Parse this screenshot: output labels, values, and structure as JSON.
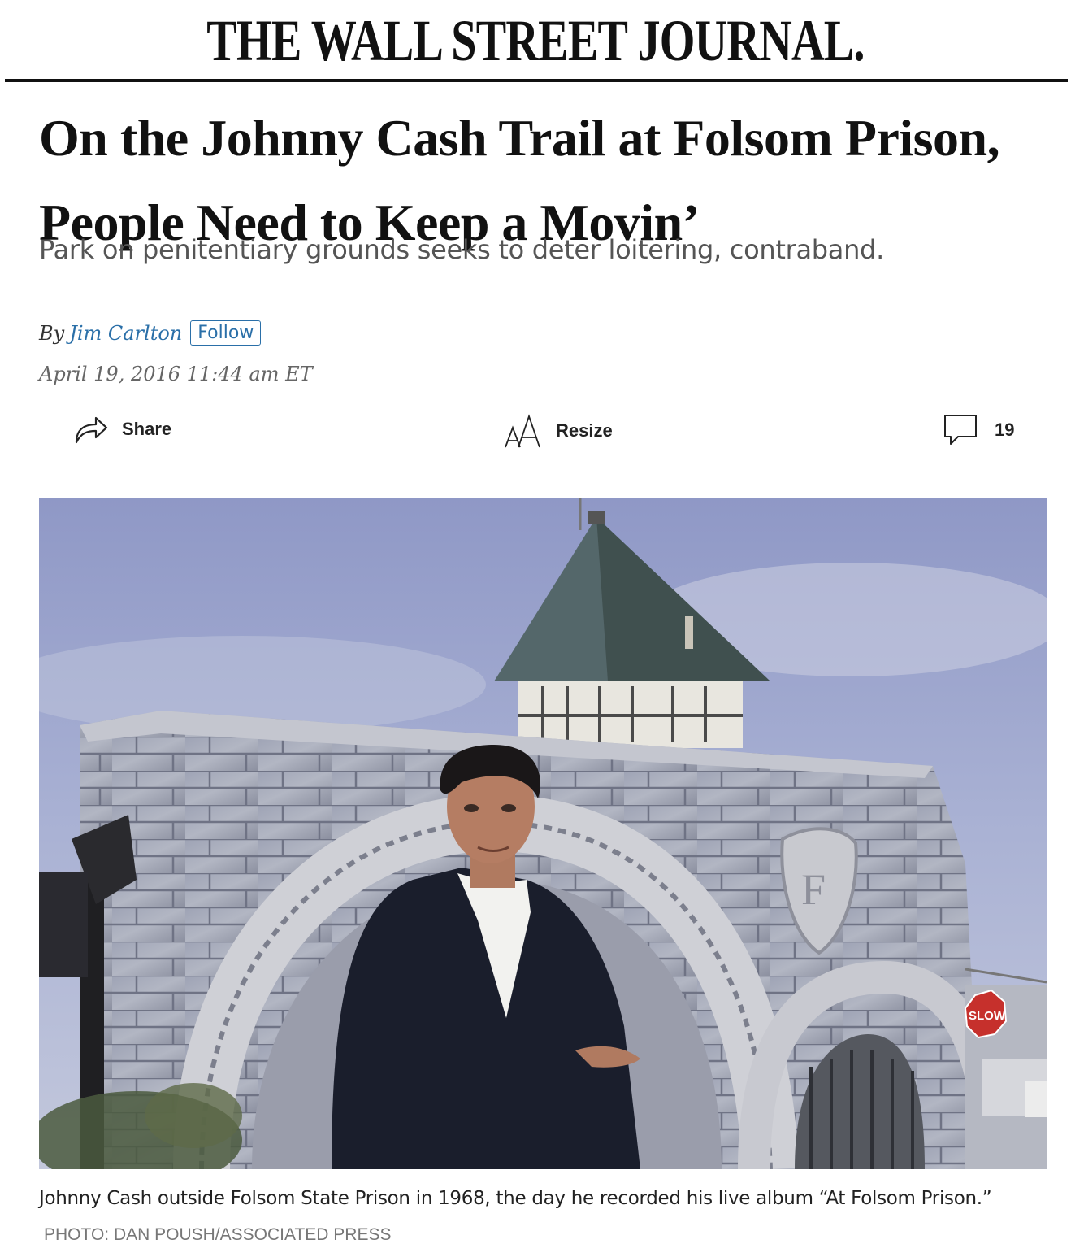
{
  "masthead": {
    "title": "THE WALL STREET JOURNAL."
  },
  "article": {
    "headline": "On the Johnny Cash Trail at Folsom Prison, People Need to Keep a Movin’",
    "dek": "Park on penitentiary grounds seeks to deter loitering, contraband.",
    "byline_prefix": "By",
    "author": "Jim Carlton",
    "follow_label": "Follow",
    "timestamp": "April 19, 2016 11:44 am ET"
  },
  "tools": {
    "share_label": "Share",
    "resize_label": "Resize",
    "comment_count": "19"
  },
  "photo": {
    "sign_text": "SLOW",
    "caption": "Johnny Cash outside Folsom State Prison in 1968, the day he recorded his live album “At Folsom Prison.”",
    "credit": "PHOTO: DAN POUSH/ASSOCIATED PRESS"
  },
  "icons": [
    "share-arrow-icon",
    "resize-text-icon",
    "comment-bubble-icon"
  ],
  "colors": {
    "link_blue": "#2a6fa8",
    "text": "#111111",
    "dek_gray": "#555555"
  }
}
